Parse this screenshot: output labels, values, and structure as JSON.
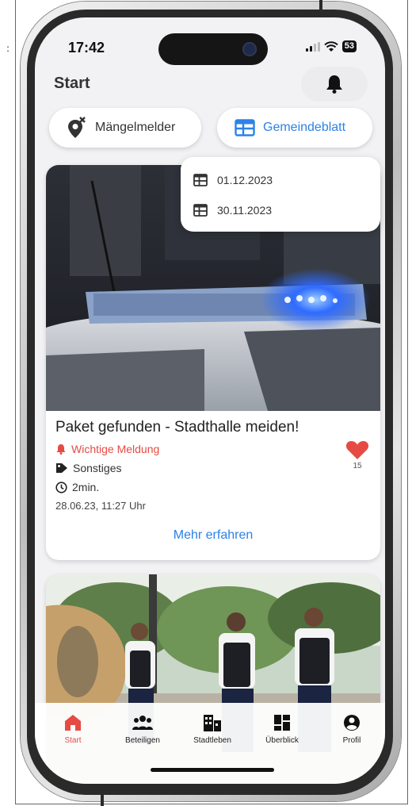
{
  "status_bar": {
    "time": "17:42",
    "battery": "53"
  },
  "header": {
    "title": "Start",
    "bell_icon": "bell-icon"
  },
  "quick_actions": [
    {
      "label": "Mängelmelder",
      "icon": "location-x-icon"
    },
    {
      "label": "Gemeindeblatt",
      "icon": "newspaper-icon"
    }
  ],
  "dropdown": {
    "items": [
      "01.12.2023",
      "30.11.2023"
    ]
  },
  "news": {
    "title": "Paket gefunden - Stadthalle meiden!",
    "important": "Wichtige Meldung",
    "category": "Sonstiges",
    "duration": "2min.",
    "date": "28.06.23, 11:27 Uhr",
    "likes": "15",
    "more": "Mehr erfahren"
  },
  "tabbar": {
    "items": [
      {
        "label": "Start",
        "icon": "house-icon",
        "active": true
      },
      {
        "label": "Beteiligen",
        "icon": "people-icon",
        "active": false
      },
      {
        "label": "Stadtleben",
        "icon": "city-icon",
        "active": false
      },
      {
        "label": "Überblick",
        "icon": "dashboard-icon",
        "active": false
      },
      {
        "label": "Profil",
        "icon": "profile-icon",
        "active": false
      }
    ]
  },
  "colors": {
    "accent_blue": "#2b82e8",
    "accent_red": "#e54b43"
  }
}
